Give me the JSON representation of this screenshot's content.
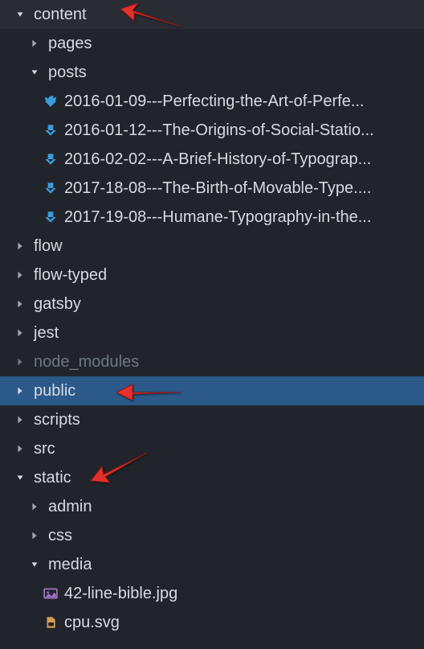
{
  "tree": {
    "content": {
      "label": "content",
      "expanded": true
    },
    "pages": {
      "label": "pages",
      "expanded": false
    },
    "posts": {
      "label": "posts",
      "expanded": true
    },
    "post_files": [
      "2016-01-09---Perfecting-the-Art-of-Perfe...",
      "2016-01-12---The-Origins-of-Social-Statio...",
      "2016-02-02---A-Brief-History-of-Typograp...",
      "2017-18-08---The-Birth-of-Movable-Type....",
      "2017-19-08---Humane-Typography-in-the..."
    ],
    "flow": {
      "label": "flow",
      "expanded": false
    },
    "flow_typed": {
      "label": "flow-typed",
      "expanded": false
    },
    "gatsby": {
      "label": "gatsby",
      "expanded": false
    },
    "jest": {
      "label": "jest",
      "expanded": false
    },
    "node_modules": {
      "label": "node_modules",
      "expanded": false
    },
    "public": {
      "label": "public",
      "expanded": false
    },
    "scripts": {
      "label": "scripts",
      "expanded": false
    },
    "src": {
      "label": "src",
      "expanded": false
    },
    "static": {
      "label": "static",
      "expanded": true
    },
    "admin": {
      "label": "admin",
      "expanded": false
    },
    "css": {
      "label": "css",
      "expanded": false
    },
    "media": {
      "label": "media",
      "expanded": true
    },
    "media_files": {
      "bible_jpg": "42-line-bible.jpg",
      "cpu_svg": "cpu.svg"
    }
  },
  "colors": {
    "accent_arrow": "#e5302b",
    "markdown_icon": "#3a9bdc",
    "image_icon": "#a074c4",
    "svg_icon": "#d39e52",
    "selected_bg": "#2b5a8a"
  }
}
